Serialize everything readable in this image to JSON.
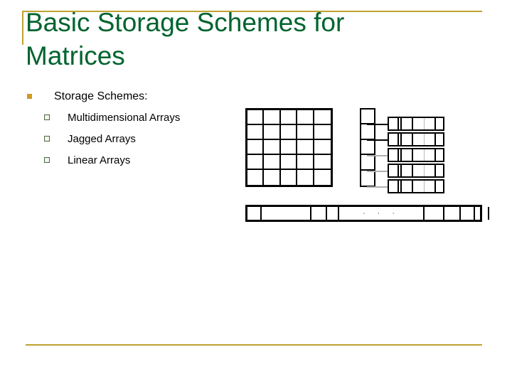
{
  "slide": {
    "title": "Basic Storage Schemes for Matrices",
    "title_color": "#00642e",
    "accent_color": "#bfa230",
    "background": "#ffffff"
  },
  "body": {
    "level1": {
      "text": "Storage Schemes:",
      "bullet_glyph": "filled-square",
      "bullet_color": "#d09b20"
    },
    "level2": [
      {
        "text": "Multidimensional Arrays",
        "bullet_glyph": "hollow-square"
      },
      {
        "text": "Jagged Arrays",
        "bullet_glyph": "hollow-square"
      },
      {
        "text": "Linear Arrays",
        "bullet_glyph": "hollow-square"
      }
    ]
  },
  "diagrams": {
    "multidimensional_grid": {
      "rows": 5,
      "columns": 5,
      "border_color": "#000000"
    },
    "jagged_array": {
      "pointer_column_cells": 5,
      "rows": 5,
      "cells_per_row": 5,
      "border_color": "#000000"
    },
    "linear_array": {
      "segments": 10,
      "ellipsis": "· · ·",
      "border_color": "#000000"
    }
  }
}
